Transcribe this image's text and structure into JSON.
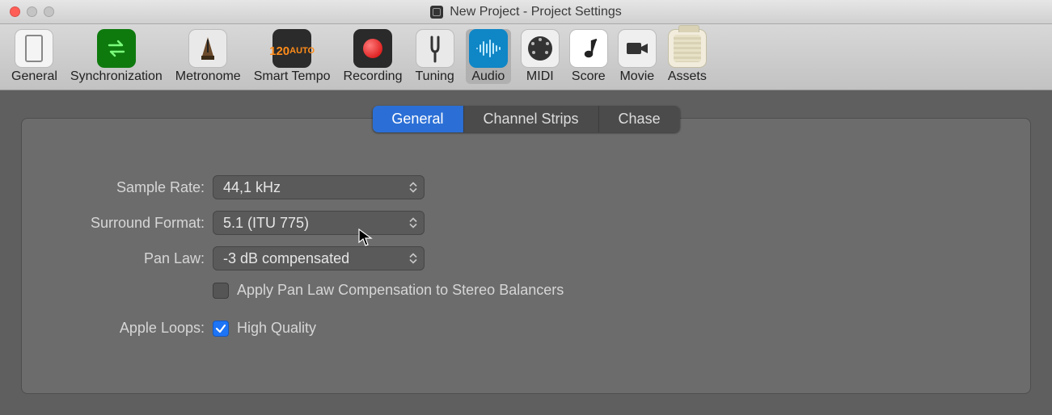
{
  "window": {
    "title": "New Project - Project Settings"
  },
  "toolbar": {
    "items": [
      {
        "id": "general",
        "label": "General"
      },
      {
        "id": "synchronization",
        "label": "Synchronization"
      },
      {
        "id": "metronome",
        "label": "Metronome"
      },
      {
        "id": "smart-tempo",
        "label": "Smart Tempo"
      },
      {
        "id": "recording",
        "label": "Recording"
      },
      {
        "id": "tuning",
        "label": "Tuning"
      },
      {
        "id": "audio",
        "label": "Audio",
        "active": true
      },
      {
        "id": "midi",
        "label": "MIDI"
      },
      {
        "id": "score",
        "label": "Score"
      },
      {
        "id": "movie",
        "label": "Movie"
      },
      {
        "id": "assets",
        "label": "Assets"
      }
    ]
  },
  "tabs": {
    "items": [
      {
        "id": "general-tab",
        "label": "General",
        "active": true
      },
      {
        "id": "channel-strips-tab",
        "label": "Channel Strips"
      },
      {
        "id": "chase-tab",
        "label": "Chase"
      }
    ]
  },
  "form": {
    "sample_rate": {
      "label": "Sample Rate:",
      "value": "44,1 kHz"
    },
    "surround_format": {
      "label": "Surround Format:",
      "value": "5.1 (ITU 775)"
    },
    "pan_law": {
      "label": "Pan Law:",
      "value": "-3 dB compensated"
    },
    "pan_law_compensation": {
      "label": "Apply Pan Law Compensation to Stereo Balancers",
      "checked": false
    },
    "apple_loops": {
      "label": "Apple Loops:",
      "option_label": "High Quality",
      "checked": true
    }
  },
  "icons": {
    "tempo_num": "120",
    "tempo_auto": "AUTO"
  }
}
